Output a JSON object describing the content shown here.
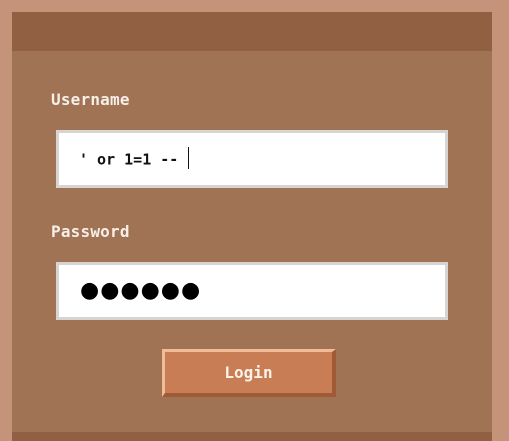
{
  "form": {
    "username_label": "Username",
    "username_value": "' or 1=1 --",
    "password_label": "Password",
    "password_masked": "●●●●●●",
    "login_label": "Login"
  },
  "colors": {
    "outer_border": "#c49379",
    "panel": "#a17355",
    "title_bar": "#915f41",
    "button": "#c97d55",
    "label_text": "#f6efe7"
  }
}
